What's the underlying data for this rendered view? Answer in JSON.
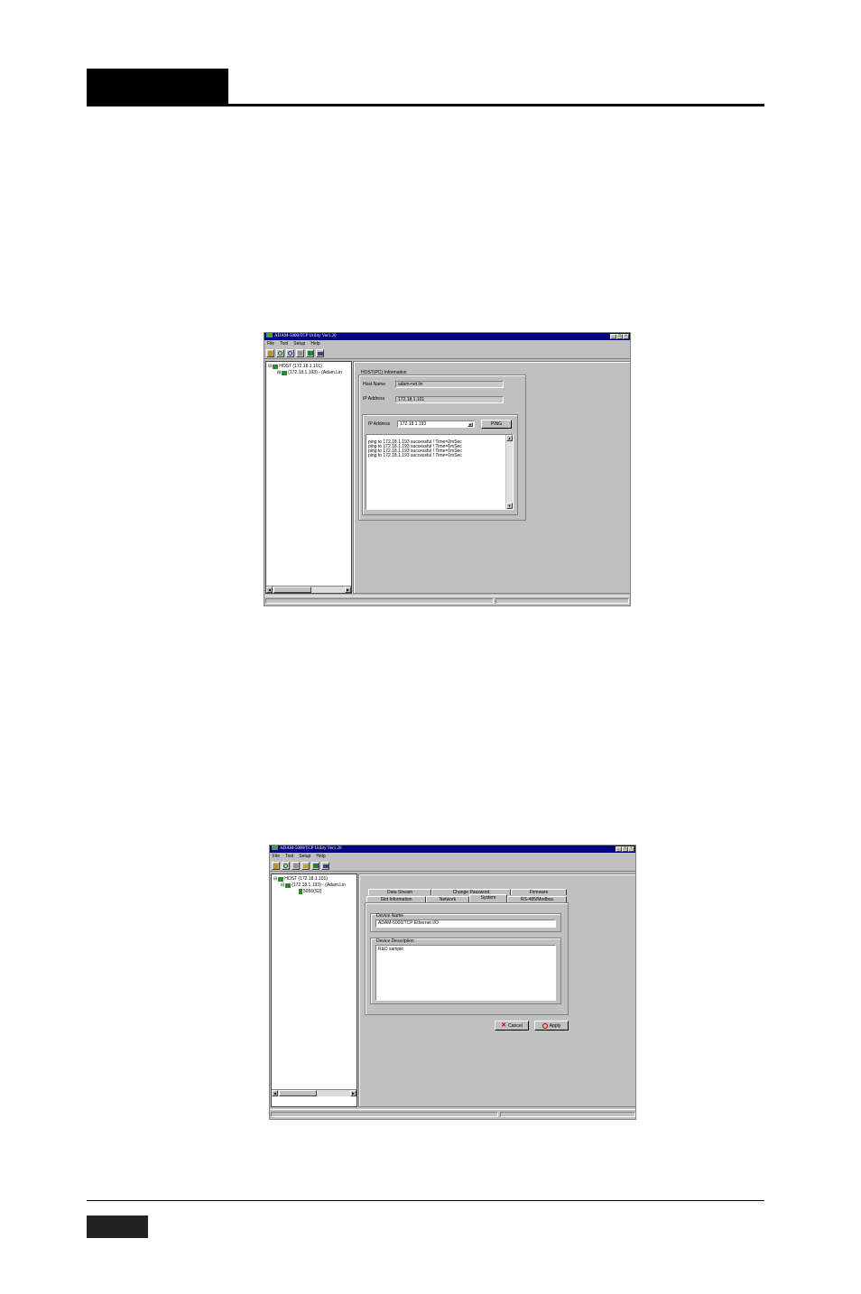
{
  "screenshot1": {
    "title": "ADAM-5000/TCP Utility Ver1.20",
    "menu": [
      "File",
      "Tool",
      "Setup",
      "Help"
    ],
    "window_controls": [
      "_",
      "□",
      "×"
    ],
    "tree": {
      "host": "HOST (172.18.1.101)",
      "device": "(172.18.1.193) - (Adam.Lin"
    },
    "info": {
      "section_label": "HOST(PC)   Information",
      "host_name_label": "Host Name",
      "host_name_value": "adam-net.lin",
      "ip_label": "IP Address",
      "ip_value": "172.18.1.101"
    },
    "ping": {
      "ip_label": "IP Address",
      "ip_value": "172.18.1.193",
      "button": "PING",
      "results": [
        "ping to 172.18.1.193 successful !  Time=2mSec",
        "ping to 172.18.1.193 successful !  Time=1mSec",
        "ping to 172.18.1.193 successful !  Time=1mSec",
        "ping to 172.18.1.193 successful !  Time=1mSec"
      ]
    }
  },
  "screenshot2": {
    "title": "ADAM-5000/TCP Utility Ver1.20",
    "menu": [
      "File",
      "Tool",
      "Setup",
      "Help"
    ],
    "window_controls": [
      "_",
      "□",
      "×"
    ],
    "tree": {
      "host": "HOST (172.18.1.101)",
      "device": "(172.18.1.193) - (Adam.Lin",
      "slot": "5056(S2)"
    },
    "tabs_top": [
      "Data Stream",
      "Change Password",
      "Firmware"
    ],
    "tabs_bottom": [
      "Slot Information",
      "Network",
      "System",
      "RS-485/Modbus"
    ],
    "device_name_label": "Device Name",
    "device_name_value": "ADAM-5000/TCP Ethernet I/O",
    "device_desc_label": "Device Description",
    "device_desc_value": "R&D sample",
    "cancel_label": "Cancel",
    "apply_label": "Apply"
  }
}
